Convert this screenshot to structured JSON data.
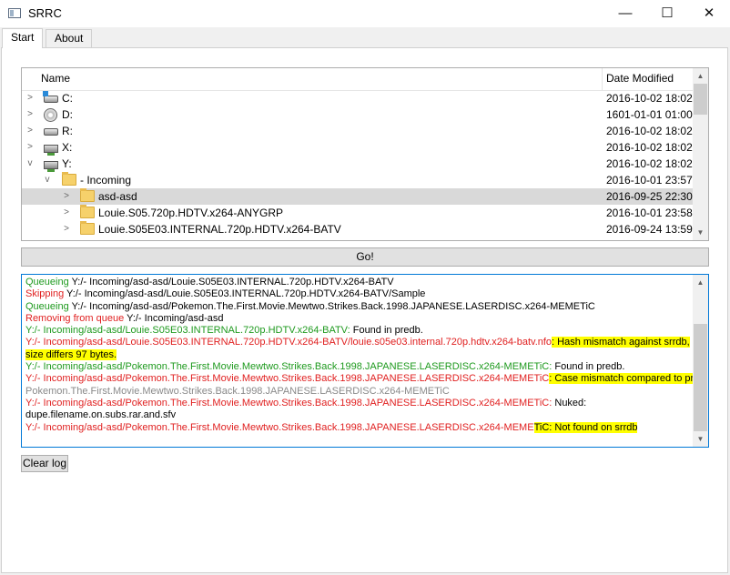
{
  "window": {
    "title": "SRRC",
    "minimize": "—",
    "maximize": "☐",
    "close": "✕"
  },
  "tabs": [
    {
      "label": "Start"
    },
    {
      "label": "About"
    }
  ],
  "tree": {
    "columns": {
      "name": "Name",
      "date": "Date Modified"
    },
    "rows": [
      {
        "name": "C:",
        "date": "2016-10-02 18:02",
        "icon": "system-drive-icon"
      },
      {
        "name": "D:",
        "date": "1601-01-01 01:00",
        "icon": "optical-drive-icon"
      },
      {
        "name": "R:",
        "date": "2016-10-02 18:02",
        "icon": "drive-icon"
      },
      {
        "name": "X:",
        "date": "2016-10-02 18:02",
        "icon": "network-drive-icon"
      },
      {
        "name": "Y:",
        "date": "2016-10-02 18:02",
        "icon": "network-drive-icon"
      },
      {
        "name": "- Incoming",
        "date": "2016-10-01 23:57",
        "icon": "folder-icon"
      },
      {
        "name": "asd-asd",
        "date": "2016-09-25 22:30",
        "icon": "folder-icon"
      },
      {
        "name": "Louie.S05.720p.HDTV.x264-ANYGRP",
        "date": "2016-10-01 23:58",
        "icon": "folder-icon"
      },
      {
        "name": "Louie.S05E03.INTERNAL.720p.HDTV.x264-BATV",
        "date": "2016-09-24 13:59",
        "icon": "folder-icon"
      }
    ]
  },
  "go_button": "Go!",
  "log": {
    "l1a": "Queueing",
    "l1b": " Y:/- Incoming/asd-asd/Louie.S05E03.INTERNAL.720p.HDTV.x264-BATV",
    "l2a": "Skipping",
    "l2b": " Y:/- Incoming/asd-asd/Louie.S05E03.INTERNAL.720p.HDTV.x264-BATV/Sample",
    "l3a": "Queueing",
    "l3b": " Y:/- Incoming/asd-asd/Pokemon.The.First.Movie.Mewtwo.Strikes.Back.1998.JAPANESE.LASERDISC.x264-MEMETiC",
    "l4a": "Removing from queue",
    "l4b": " Y:/- Incoming/asd-asd",
    "l5a": "Y:/- Incoming/asd-asd/Louie.S05E03.INTERNAL.720p.HDTV.x264-BATV:",
    "l5b": " Found in predb.",
    "l6a": "Y:/- Incoming/asd-asd/Louie.S05E03.INTERNAL.720p.HDTV.x264-BATV/louie.s05e03.internal.720p.hdtv.x264-batv.nfo",
    "l6b": ": Hash mismatch against srrdb,",
    "l7": "size differs 97 bytes.",
    "l8a": "Y:/- Incoming/asd-asd/Pokemon.The.First.Movie.Mewtwo.Strikes.Back.1998.JAPANESE.LASERDISC.x264-MEMETiC:",
    "l8b": " Found in predb.",
    "l9a": "Y:/- Incoming/asd-asd/Pokemon.The.First.Movie.Mewtwo.Strikes.Back.1998.JAPANESE.LASERDISC.x264-MEMETiC",
    "l9b": ": Case mismatch compared to predb:",
    "l10": "Pokemon.The.First.Movie.Mewtwo.Strikes.Back.1998.JAPANESE.LASERDISC.x264-MEMETiC",
    "l11a": "Y:/- Incoming/asd-asd/Pokemon.The.First.Movie.Mewtwo.Strikes.Back.1998.JAPANESE.LASERDISC.x264-MEMETiC:",
    "l11b": " Nuked:",
    "l12": "dupe.filename.on.subs.rar.and.sfv",
    "l13a": "Y:/- Incoming/asd-asd/Pokemon.The.First.Movie.Mewtwo.Strikes.Back.1998.JAPANESE.LASERDISC.x264-MEME",
    "l13b": "TiC: Not found on srrdb"
  },
  "clear_button": "Clear log",
  "colors": {
    "ok": "#1e9a1e",
    "error": "#e02020",
    "muted": "#8a8a8a",
    "highlight": "#ffff00",
    "focus": "#0078d7"
  }
}
